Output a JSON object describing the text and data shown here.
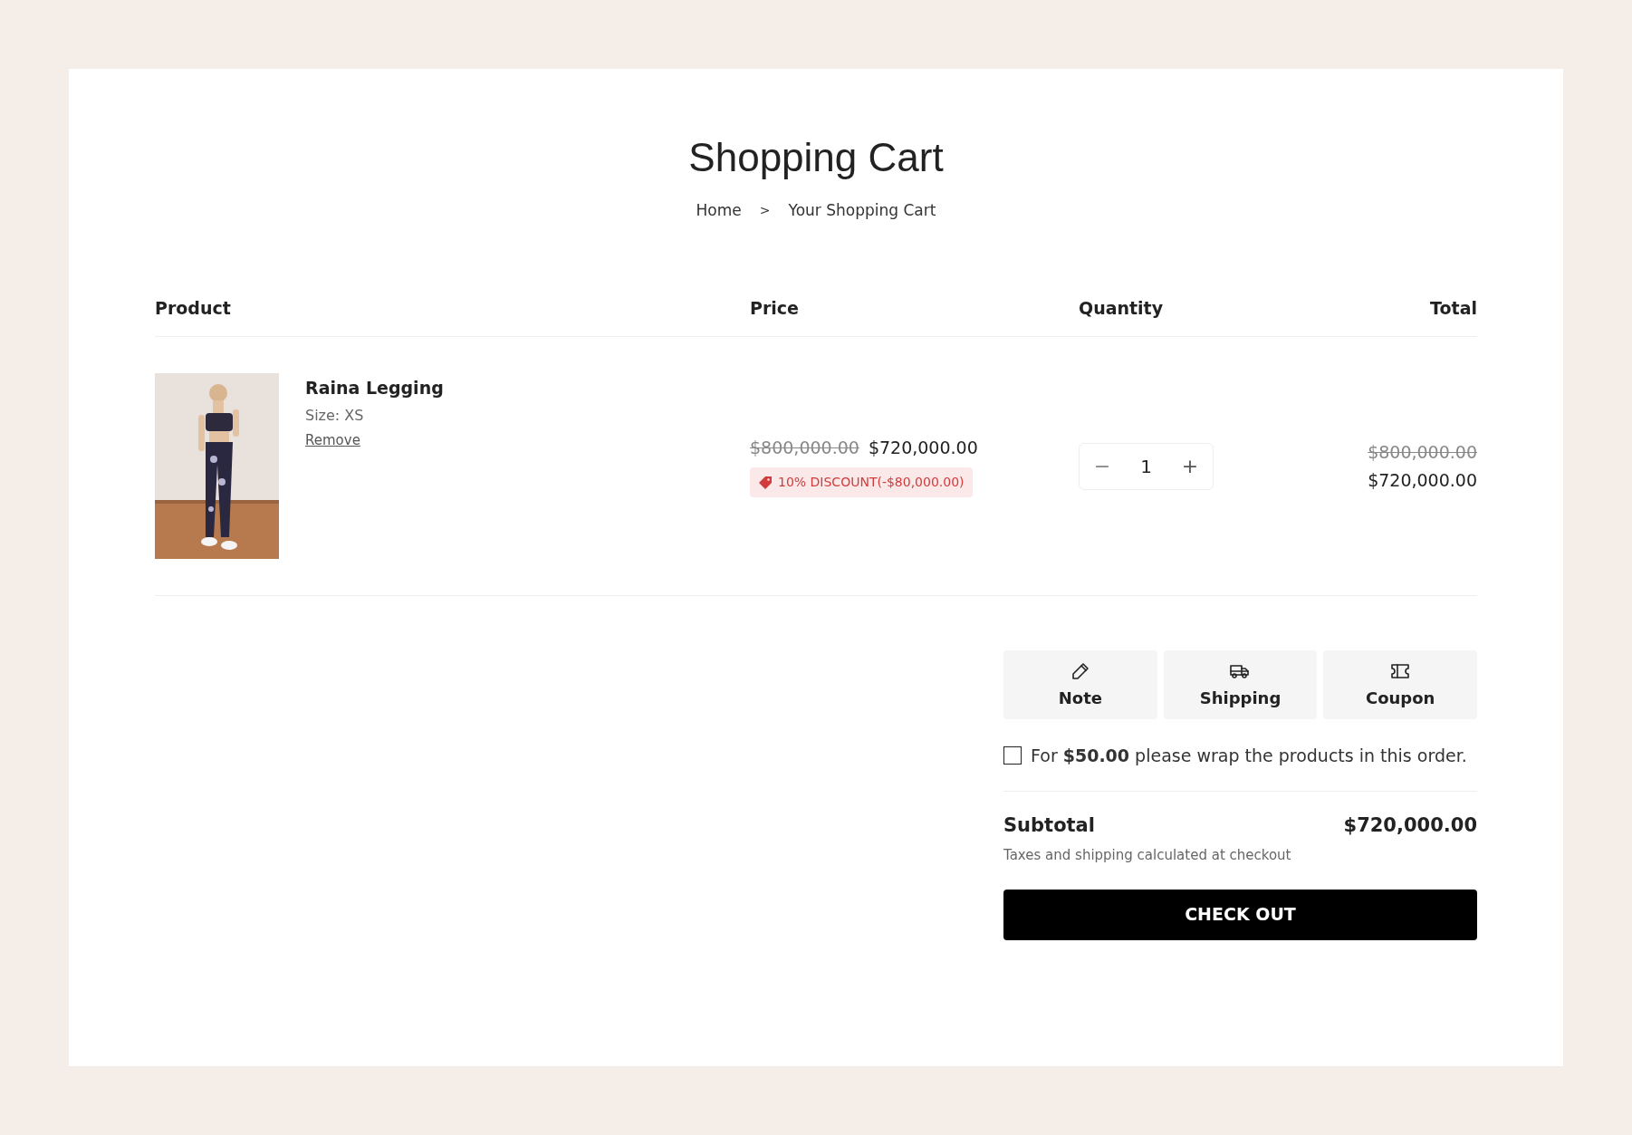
{
  "page": {
    "title": "Shopping Cart"
  },
  "breadcrumb": [
    {
      "label": "Home"
    },
    {
      "label": "Your Shopping Cart"
    }
  ],
  "breadcrumb_separator": ">",
  "table": {
    "columns": [
      "Product",
      "Price",
      "Quantity",
      "Total"
    ],
    "rows": [
      {
        "name": "Raina Legging",
        "size": "Size: XS",
        "remove": "Remove",
        "price_original": "$800,000.00",
        "price": "$720,000.00",
        "discount": "10% DISCOUNT(-$80,000.00)",
        "quantity": "1",
        "decrease": "−",
        "increase": "+",
        "total_original": "$800,000.00",
        "total": "$720,000.00"
      }
    ]
  },
  "tabs": [
    {
      "kind": "note",
      "label": "Note"
    },
    {
      "kind": "shipping",
      "label": "Shipping"
    },
    {
      "kind": "coupon",
      "label": "Coupon"
    }
  ],
  "gift_wrap": {
    "checked": false,
    "text": "For **$50.00** please wrap the products in this order."
  },
  "subtotal": {
    "label": "Subtotal",
    "value": "$720,000.00",
    "note": "Taxes and shipping calculated at checkout"
  },
  "checkout_button": "CHECK OUT"
}
